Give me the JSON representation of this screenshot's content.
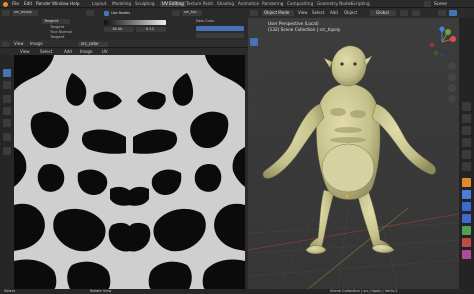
{
  "menubar": {
    "items": [
      "File",
      "Edit",
      "Render",
      "Window",
      "Help"
    ],
    "tabs": [
      "Layout",
      "Modeling",
      "Sculpting",
      "UV Editing",
      "Texture Paint",
      "Shading",
      "Animation",
      "Rendering",
      "Compositing",
      "Geometry Nodes",
      "Scripting"
    ],
    "active_tab": "UV Editing",
    "scene_label": "Scene"
  },
  "header": {
    "object_name": "src_hipoly",
    "use_nodes_label": "Use Nodes",
    "rows_left": [
      "Tangent",
      "Tangent",
      "Tangent",
      "Tangent",
      "True Normal",
      "Tangent"
    ],
    "dropdown_value": "Tangent",
    "new_color_label": "New Color",
    "image_name": "src_hip",
    "slider_labels": [
      "16.00",
      "0.12"
    ]
  },
  "uv": {
    "editor_label": "View",
    "image_label": "Image",
    "image_name": "src_color",
    "menu_items": [
      "View",
      "Select",
      "Add",
      "Image",
      "UV"
    ]
  },
  "viewport": {
    "mode": "Object Mode",
    "menu_items": [
      "View",
      "Select",
      "Add",
      "Object"
    ],
    "perspective_label": "User Perspective (Local)",
    "collection_label": "(132) Scene Collection | src_hipoly",
    "gizmo_axes": [
      "X",
      "Y",
      "Z"
    ],
    "global_label": "Global"
  },
  "status": {
    "left": "Select",
    "mid": "Rotate View",
    "right": "Scene Collection | src_hipoly | Verts:1"
  },
  "colors": {
    "accent": "#4772b3",
    "model": "#c4c08a",
    "axis_x": "#e05050",
    "axis_y": "#6ca33a",
    "axis_z": "#4a7de0"
  }
}
